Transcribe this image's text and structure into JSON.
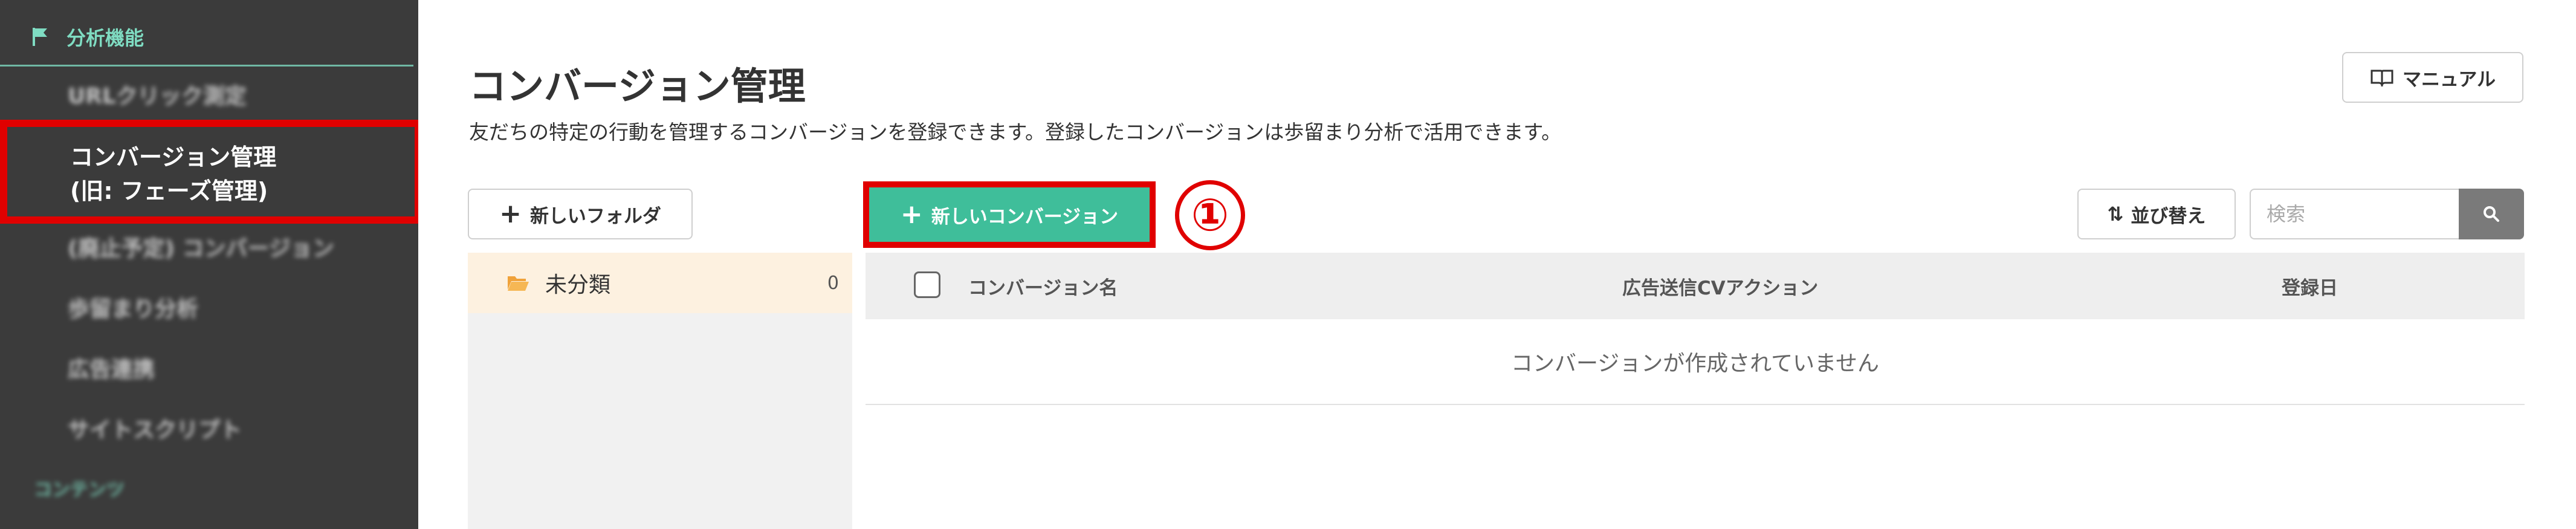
{
  "sidebar": {
    "section_label": "分析機能",
    "items": [
      {
        "label": "URLクリック測定"
      },
      {
        "label_line1": "コンバージョン管理",
        "label_line2": "(旧: フェーズ管理)"
      },
      {
        "label": "(廃止予定) コンバージョン"
      },
      {
        "label": "歩留まり分析"
      },
      {
        "label": "広告連携"
      },
      {
        "label": "サイトスクリプト"
      },
      {
        "label": "コンテンツ"
      }
    ]
  },
  "header": {
    "title": "コンバージョン管理",
    "description": "友だちの特定の行動を管理するコンバージョンを登録できます。登録したコンバージョンは歩留まり分析で活用できます。",
    "manual_label": "マニュアル"
  },
  "toolbar": {
    "new_folder_label": "新しいフォルダ",
    "new_conversion_label": "新しいコンバージョン",
    "step_marker": "①",
    "sort_label": "並び替え",
    "search_placeholder": "検索"
  },
  "folders": [
    {
      "name": "未分類",
      "count": "0"
    }
  ],
  "table": {
    "columns": [
      "コンバージョン名",
      "広告送信CVアクション",
      "登録日"
    ],
    "empty_message": "コンバージョンが作成されていません"
  },
  "colors": {
    "sidebar_bg": "#3b3b3b",
    "accent": "#3fbe9a",
    "highlight": "#e00000",
    "folder_selected_bg": "#fdf1e0"
  }
}
